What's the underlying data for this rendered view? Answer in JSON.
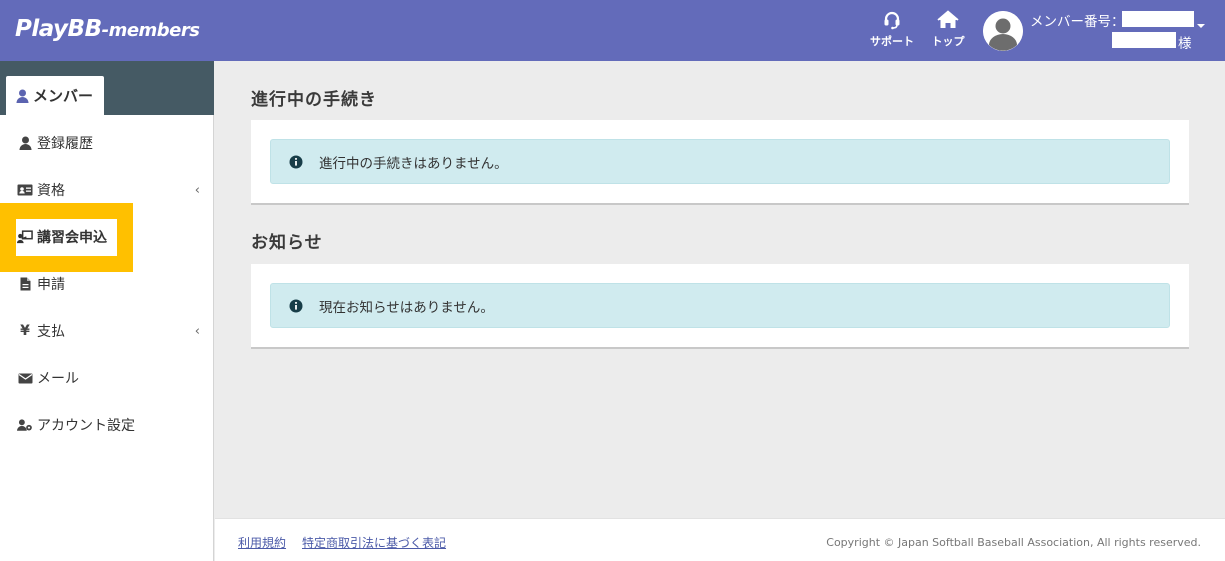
{
  "header": {
    "logo_main": "PlayBB",
    "logo_sub": "-members",
    "support_label": "サポート",
    "top_label": "トップ",
    "member_no_label": "メンバー番号：",
    "honorific": "様"
  },
  "sidebar": {
    "tab_label": "メンバー",
    "items": [
      {
        "label": "登録履歴",
        "icon": "user-icon"
      },
      {
        "label": "資格",
        "icon": "id-card-icon",
        "has_submenu": true
      },
      {
        "label": "講習会申込",
        "icon": "chalkboard-teacher-icon",
        "highlighted": true
      },
      {
        "label": "申請",
        "icon": "file-icon"
      },
      {
        "label": "支払",
        "icon": "yen-icon",
        "has_submenu": true
      },
      {
        "label": "メール",
        "icon": "envelope-icon"
      },
      {
        "label": "アカウント設定",
        "icon": "user-cog-icon"
      }
    ],
    "chevron": "‹",
    "yen": "¥"
  },
  "main": {
    "sections": [
      {
        "title": "進行中の手続き",
        "message": "進行中の手続きはありません。"
      },
      {
        "title": "お知らせ",
        "message": "現在お知らせはありません。"
      }
    ]
  },
  "footer": {
    "links": [
      "利用規約",
      "特定商取引法に基づく表記"
    ],
    "copyright": "Copyright © Japan Softball Baseball Association, All rights reserved."
  },
  "colors": {
    "header_bg": "#636bba",
    "sidebar_top_bg": "#455a64",
    "highlight": "#ffc000",
    "alert_bg": "#d0ebef",
    "link": "#4b5aa8"
  }
}
